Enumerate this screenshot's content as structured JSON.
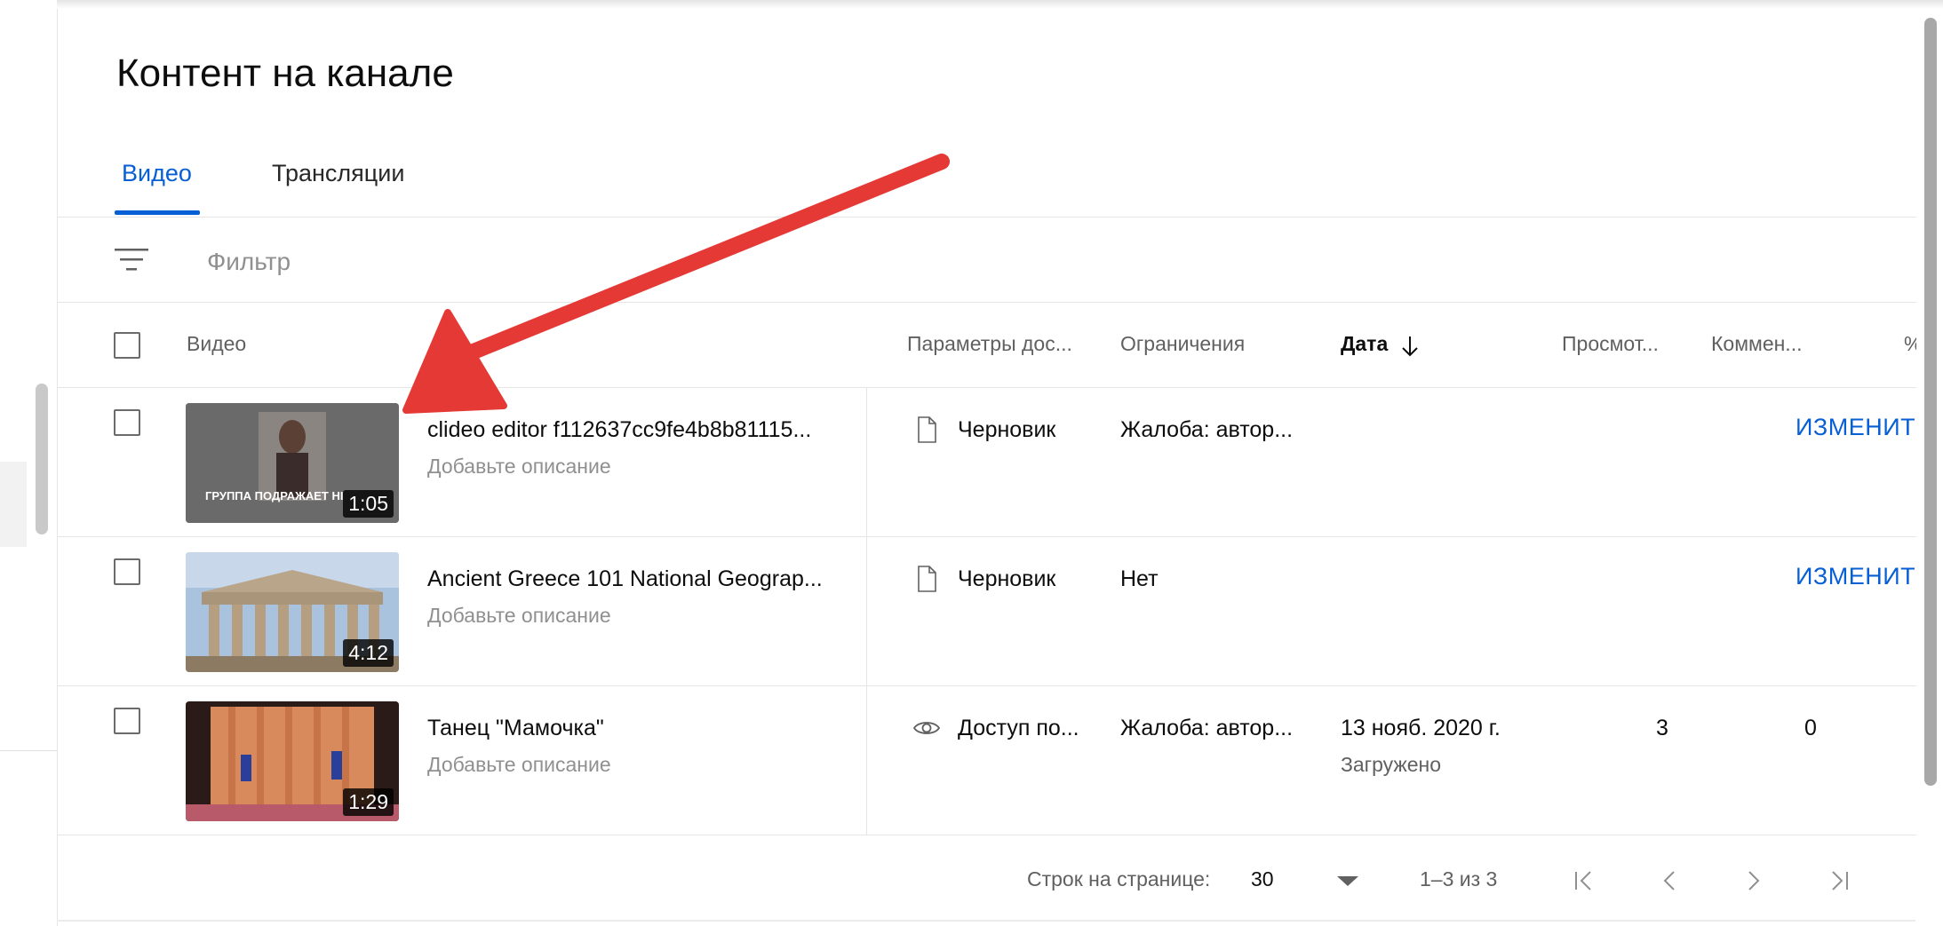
{
  "page": {
    "title": "Контент на канале"
  },
  "tabs": [
    {
      "label": "Видео",
      "active": true
    },
    {
      "label": "Трансляции",
      "active": false
    }
  ],
  "filter": {
    "placeholder": "Фильтр",
    "icon": "filter-list-icon"
  },
  "table": {
    "headers": {
      "video": "Видео",
      "visibility": "Параметры дос...",
      "restrictions": "Ограничения",
      "date": "Дата",
      "views": "Просмот...",
      "comments": "Коммен...",
      "percent": "%"
    },
    "sort_icon": "arrow-down-icon",
    "rows": [
      {
        "title": "clideo editor f112637cc9fe4b8b81115...",
        "description": "Добавьте описание",
        "duration": "1:05",
        "thumb_caption": "ГРУППА ПОДРАЖАЕТ НІ",
        "visibility": "Черновик",
        "visibility_icon": "draft-file-icon",
        "restrictions": "Жалоба: автор...",
        "date": "",
        "date_sub": "",
        "views": "",
        "comments": "",
        "action": "ИЗМЕНИТ"
      },
      {
        "title": "Ancient Greece 101 National Geograp...",
        "description": "Добавьте описание",
        "duration": "4:12",
        "thumb_caption": "",
        "visibility": "Черновик",
        "visibility_icon": "draft-file-icon",
        "restrictions": "Нет",
        "date": "",
        "date_sub": "",
        "views": "",
        "comments": "",
        "action": "ИЗМЕНИТ"
      },
      {
        "title": "Танец \"Мамочка\"",
        "description": "Добавьте описание",
        "duration": "1:29",
        "thumb_caption": "",
        "visibility": "Доступ по...",
        "visibility_icon": "eye-icon",
        "restrictions": "Жалоба: автор...",
        "date": "13 нояб. 2020 г.",
        "date_sub": "Загружено",
        "views": "3",
        "comments": "0",
        "action": ""
      }
    ]
  },
  "pagination": {
    "rows_label": "Строк на странице:",
    "rows_value": "30",
    "range": "1–3 из 3"
  },
  "colors": {
    "accent": "#065fd4",
    "annotation_arrow": "#e53935",
    "text_primary": "#0d0d0d",
    "text_secondary": "#606060"
  }
}
